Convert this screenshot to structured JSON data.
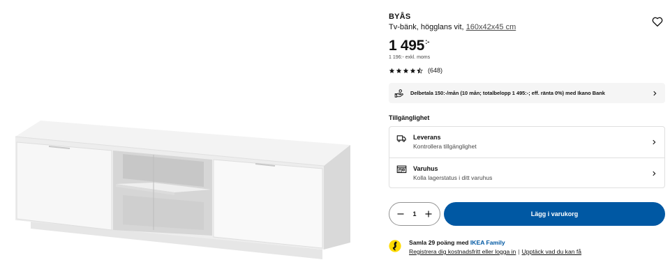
{
  "product": {
    "name": "BYÅS",
    "description": "Tv-bänk, högglans vit,",
    "dimensions": "160x42x45 cm",
    "price_main": "1 495",
    "price_suffix": ":-",
    "price_ex_vat": "1 196:- exkl. moms",
    "rating_value": 4.5,
    "rating_count": "(648)"
  },
  "financing": {
    "text": "Delbetala 150:-/mån (10 mån; totalbelopp 1 495:-; eff. ränta 0%) med Ikano Bank"
  },
  "availability": {
    "title": "Tillgänglighet",
    "delivery": {
      "heading": "Leverans",
      "subtext": "Kontrollera tillgänglighet"
    },
    "store": {
      "heading": "Varuhus",
      "subtext": "Kolla lagerstatus i ditt varuhus"
    }
  },
  "cart": {
    "quantity": "1",
    "add_label": "Lägg i varukorg"
  },
  "family": {
    "line1_prefix": "Samla 29 poäng med",
    "brand": "IKEA Family",
    "register_link": "Registrera dig kostnadsfritt eller logga in",
    "separator": "|",
    "discover_link": "Upptäck vad du kan få"
  },
  "colors": {
    "accent_blue": "#0058a3",
    "family_yellow": "#ffdb00",
    "text": "#111111",
    "muted": "#484848",
    "panel_bg": "#f5f5f5"
  }
}
